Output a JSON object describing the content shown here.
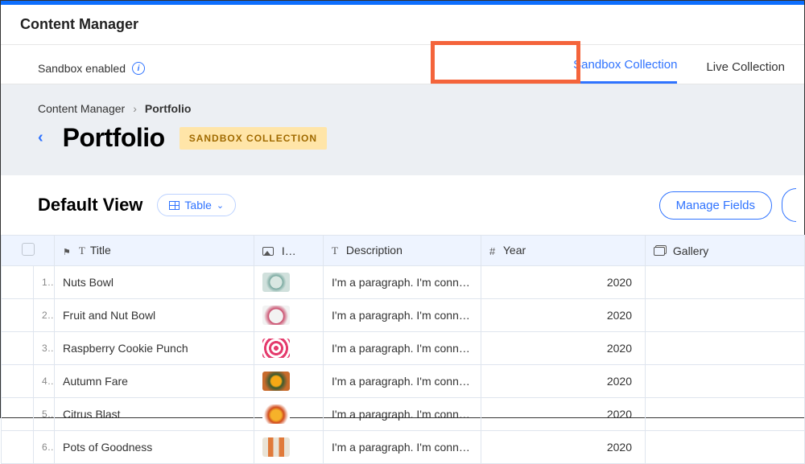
{
  "accent_color": "#2f73ff",
  "highlight_color": "#f4643b",
  "app_title": "Content Manager",
  "sandbox": {
    "label": "Sandbox enabled"
  },
  "tabs": {
    "sandbox": "Sandbox Collection",
    "live": "Live Collection"
  },
  "breadcrumb": {
    "root": "Content Manager",
    "current": "Portfolio"
  },
  "page_title": "Portfolio",
  "sandbox_badge": "SANDBOX COLLECTION",
  "view": {
    "name": "Default View",
    "mode": "Table"
  },
  "buttons": {
    "manage_fields": "Manage Fields"
  },
  "columns": {
    "title": "Title",
    "image": "I…",
    "description": "Description",
    "year": "Year",
    "gallery": "Gallery"
  },
  "rows": [
    {
      "idx": "1",
      "title": "Nuts Bowl",
      "image": "thumb-bowl-green",
      "description": "I'm a paragraph. I'm conn…",
      "year": "2020"
    },
    {
      "idx": "2",
      "title": "Fruit and Nut Bowl",
      "image": "thumb-bowl-white",
      "description": "I'm a paragraph. I'm conn…",
      "year": "2020"
    },
    {
      "idx": "3",
      "title": "Raspberry Cookie Punch",
      "image": "thumb-raspberries",
      "description": "I'm a paragraph. I'm conn…",
      "year": "2020"
    },
    {
      "idx": "4",
      "title": "Autumn Fare",
      "image": "thumb-autumn",
      "description": "I'm a paragraph. I'm conn…",
      "year": "2020"
    },
    {
      "idx": "5",
      "title": "Citrus Blast",
      "image": "thumb-citrus",
      "description": "I'm a paragraph. I'm conn…",
      "year": "2020"
    },
    {
      "idx": "6",
      "title": "Pots of Goodness",
      "image": "thumb-pots",
      "description": "I'm a paragraph. I'm conn…",
      "year": "2020"
    }
  ]
}
